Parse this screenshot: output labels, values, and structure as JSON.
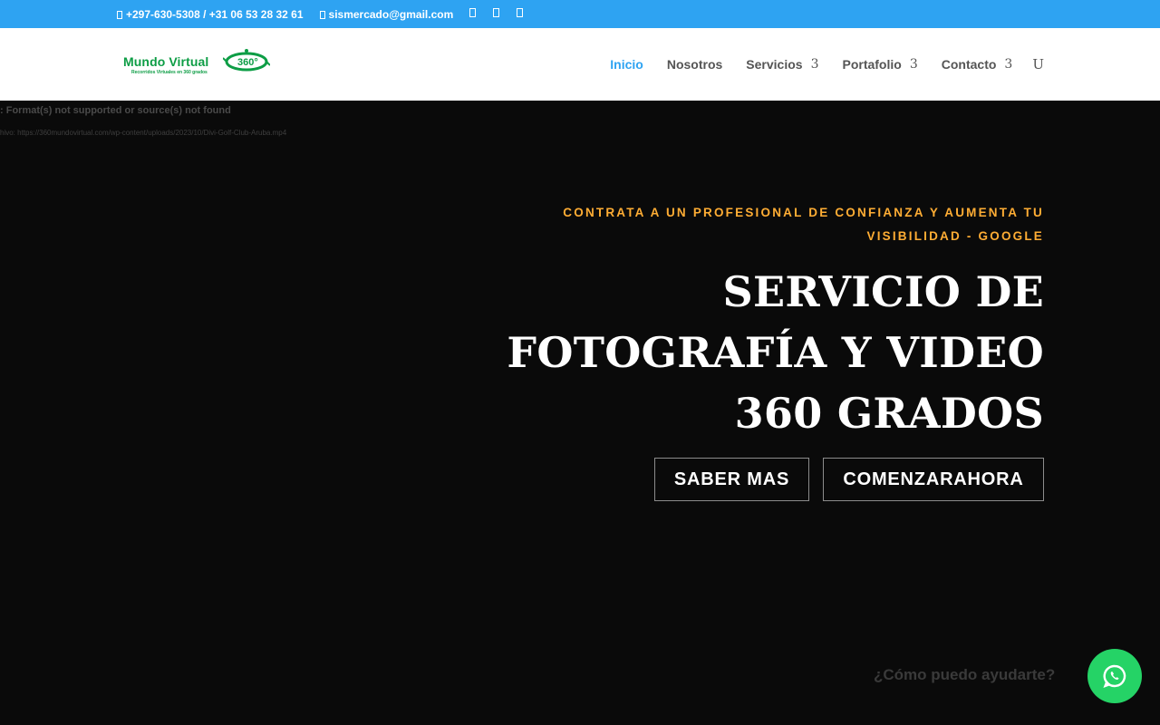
{
  "topbar": {
    "phone": "+297-630-5308 / +31 06 53 28 32 61",
    "email": "sismercado@gmail.com",
    "social_icons": [
      "facebook-icon",
      "twitter-icon",
      "instagram-icon"
    ]
  },
  "header": {
    "logo_text": "Mundo Virtual",
    "logo_subtext": "Recorridos Virtuales en 360 grados",
    "logo_badge": "360°",
    "nav": [
      {
        "label": "Inicio",
        "active": true,
        "dropdown": false
      },
      {
        "label": "Nosotros",
        "active": false,
        "dropdown": false
      },
      {
        "label": "Servicios",
        "active": false,
        "dropdown": true
      },
      {
        "label": "Portafolio",
        "active": false,
        "dropdown": true
      },
      {
        "label": "Contacto",
        "active": false,
        "dropdown": true
      }
    ],
    "caret_glyph": "3",
    "search_glyph": "U"
  },
  "hero": {
    "video_error": ": Format(s) not supported or source(s) not found",
    "video_path": "hivo: https://360mundovirtual.com/wp-content/uploads/2023/10/Divi-Golf-Club-Aruba.mp4",
    "kicker": "CONTRATA A UN PROFESIONAL DE CONFIANZA Y AUMENTA TU VISIBILIDAD - GOOGLE",
    "headline": "SERVICIO DE FOTOGRAFÍA Y VIDEO 360 GRADOS",
    "button_primary": "SABER MAS",
    "button_secondary": "COMENZARAHORA"
  },
  "chat": {
    "prompt": "¿Cómo puedo ayudarte?"
  },
  "colors": {
    "topbar_bg": "#2ea3f2",
    "accent": "#2ea3f2",
    "kicker": "#ffad34",
    "whatsapp": "#25d366",
    "logo_green": "#0d9d45"
  }
}
